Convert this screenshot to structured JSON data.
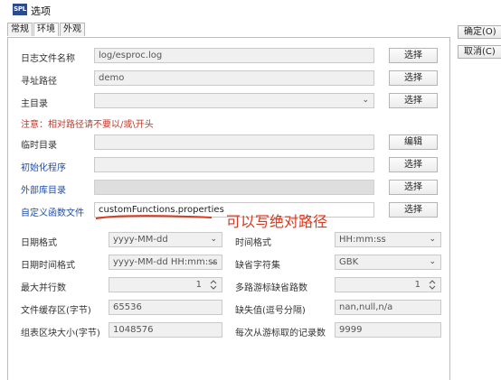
{
  "window": {
    "logo": "SPL",
    "title": "选项"
  },
  "tabs": [
    {
      "label": "常规"
    },
    {
      "label": "环境"
    },
    {
      "label": "外观"
    }
  ],
  "side_buttons": {
    "ok": "确定(O)",
    "cancel": "取消(C)"
  },
  "rows": {
    "log": {
      "label": "日志文件名称",
      "value": "log/esproc.log",
      "button": "选择"
    },
    "search_path": {
      "label": "寻址路径",
      "value": "demo",
      "button": "选择"
    },
    "main_dir": {
      "label": "主目录",
      "value": "",
      "button": "选择"
    },
    "note": "注意：相对路径请不要以/或\\开头",
    "temp_dir": {
      "label": "临时目录",
      "value": "",
      "button": "编辑"
    },
    "init_program": {
      "label": "初始化程序",
      "value": "",
      "button": "选择"
    },
    "external_lib": {
      "label": "外部库目录",
      "value": "",
      "button": "选择"
    },
    "custom_func": {
      "label": "自定义函数文件",
      "value": "customFunctions.properties",
      "button": "选择"
    }
  },
  "annotation": "可以写绝对路径",
  "settings": {
    "date_format": {
      "label": "日期格式",
      "value": "yyyy-MM-dd"
    },
    "time_format": {
      "label": "时间格式",
      "value": "HH:mm:ss"
    },
    "datetime_format": {
      "label": "日期时间格式",
      "value": "yyyy-MM-dd HH:mm:ss"
    },
    "charset": {
      "label": "缺省字符集",
      "value": "GBK"
    },
    "max_parallel": {
      "label": "最大并行数",
      "value": "1"
    },
    "cursor_parallel": {
      "label": "多路游标缺省路数",
      "value": "1"
    },
    "file_buffer": {
      "label": "文件缓存区(字节)",
      "value": "65536"
    },
    "null_values": {
      "label": "缺失值(逗号分隔)",
      "value": "nan,null,n/a"
    },
    "block_size": {
      "label": "组表区块大小(字节)",
      "value": "1048576"
    },
    "fetch_count": {
      "label": "每次从游标取的记录数",
      "value": "9999"
    }
  }
}
